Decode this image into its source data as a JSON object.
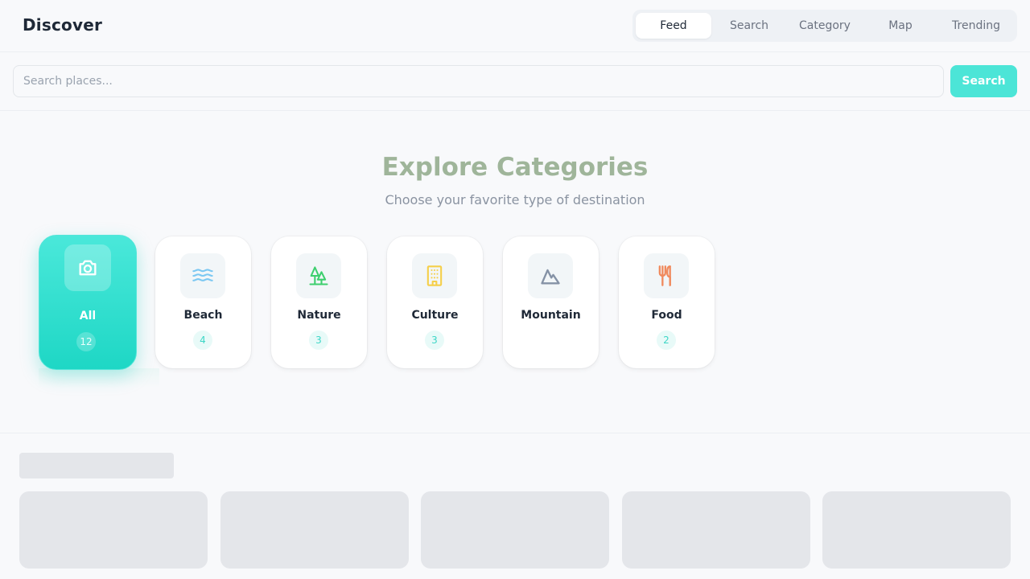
{
  "header": {
    "brand": "Discover",
    "tabs": [
      {
        "label": "Feed",
        "active": true
      },
      {
        "label": "Search",
        "active": false
      },
      {
        "label": "Category",
        "active": false
      },
      {
        "label": "Map",
        "active": false
      },
      {
        "label": "Trending",
        "active": false
      }
    ]
  },
  "search": {
    "placeholder": "Search places...",
    "value": "",
    "button_label": "Search"
  },
  "categories_section": {
    "title": "Explore Categories",
    "subtitle": "Choose your favorite type of destination",
    "items": [
      {
        "label": "All",
        "count": "12",
        "icon": "camera-icon",
        "icon_color": "#ffffff",
        "active": true
      },
      {
        "label": "Beach",
        "count": "4",
        "icon": "waves-icon",
        "icon_color": "#7cc8f2",
        "active": false
      },
      {
        "label": "Nature",
        "count": "3",
        "icon": "trees-icon",
        "icon_color": "#3ecf6e",
        "active": false
      },
      {
        "label": "Culture",
        "count": "3",
        "icon": "building-icon",
        "icon_color": "#f5cf4a",
        "active": false
      },
      {
        "label": "Mountain",
        "count": "",
        "icon": "mountain-icon",
        "icon_color": "#8592a6",
        "active": false
      },
      {
        "label": "Food",
        "count": "2",
        "icon": "utensils-icon",
        "icon_color": "#f08a5d",
        "active": false
      }
    ]
  },
  "colors": {
    "accent": "#4ce5d7",
    "title": "#9fb59a",
    "skeleton": "#e4e6ea"
  }
}
